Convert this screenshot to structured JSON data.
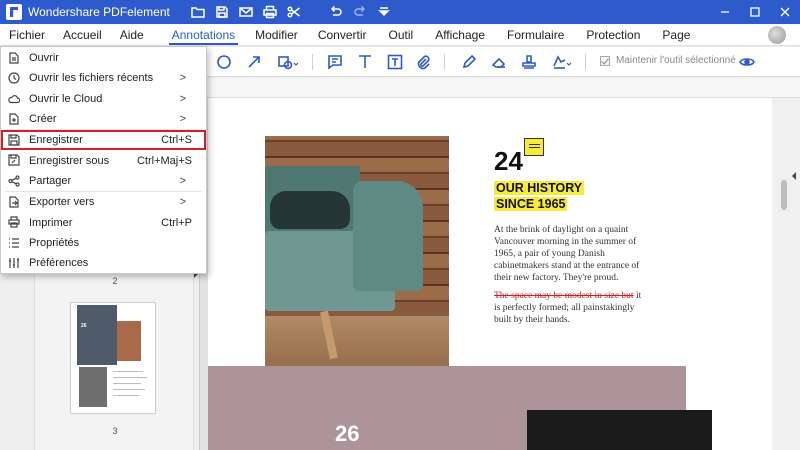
{
  "app": {
    "title": "Wondershare PDFelement"
  },
  "menubar": {
    "items": [
      "Fichier",
      "Accueil",
      "Aide",
      "Annotations",
      "Modifier",
      "Convertir",
      "Outil",
      "Affichage",
      "Formulaire",
      "Protection",
      "Page"
    ],
    "active": "Annotations"
  },
  "toolbar": {
    "keep_tool_label": "Maintenir l'outil sélectionné"
  },
  "file_menu": {
    "items": [
      {
        "label": "Ouvrir",
        "shortcut": "",
        "submenu": false,
        "icon": "file-open-icon"
      },
      {
        "label": "Ouvrir les fichiers récents",
        "shortcut": "",
        "submenu": true,
        "icon": "clock-icon"
      },
      {
        "label": "Ouvrir le Cloud",
        "shortcut": "",
        "submenu": true,
        "icon": "cloud-icon"
      },
      {
        "label": "Créer",
        "shortcut": "",
        "submenu": true,
        "icon": "create-file-icon"
      },
      {
        "label": "Enregistrer",
        "shortcut": "Ctrl+S",
        "submenu": false,
        "icon": "save-icon",
        "selected": true
      },
      {
        "label": "Enregistrer sous",
        "shortcut": "Ctrl+Maj+S",
        "submenu": false,
        "icon": "save-as-icon"
      },
      {
        "label": "Partager",
        "shortcut": "",
        "submenu": true,
        "icon": "share-icon"
      },
      {
        "label": "Exporter vers",
        "shortcut": "",
        "submenu": true,
        "icon": "export-icon"
      },
      {
        "label": "Imprimer",
        "shortcut": "Ctrl+P",
        "submenu": false,
        "icon": "print-icon"
      },
      {
        "label": "Propriétés",
        "shortcut": "",
        "submenu": false,
        "icon": "properties-icon"
      },
      {
        "label": "Préférences",
        "shortcut": "",
        "submenu": false,
        "icon": "preferences-icon"
      }
    ],
    "submenu_arrow": ">"
  },
  "thumbnails": {
    "page_labels": [
      "2",
      "3"
    ],
    "thumb_title": "26"
  },
  "document": {
    "year": "24",
    "heading_line1": "OUR HISTORY",
    "heading_line2": "SINCE 1965",
    "para1": "At the brink of daylight on a quaint Vancouver morning in the summer of 1965, a pair of young Danish cabinetmakers stand at the entrance of their new factory. They're proud.",
    "para2_struck": "The space may be modest in size but",
    "para2_rest": " it is perfectly formed; all painstakingly built by their hands.",
    "band_number": "26"
  },
  "colors": {
    "brand_blue": "#2d5bcc",
    "highlight_yellow": "#f7ea3a",
    "selection_red": "#d0202a",
    "band_mauve": "#ad949a"
  }
}
